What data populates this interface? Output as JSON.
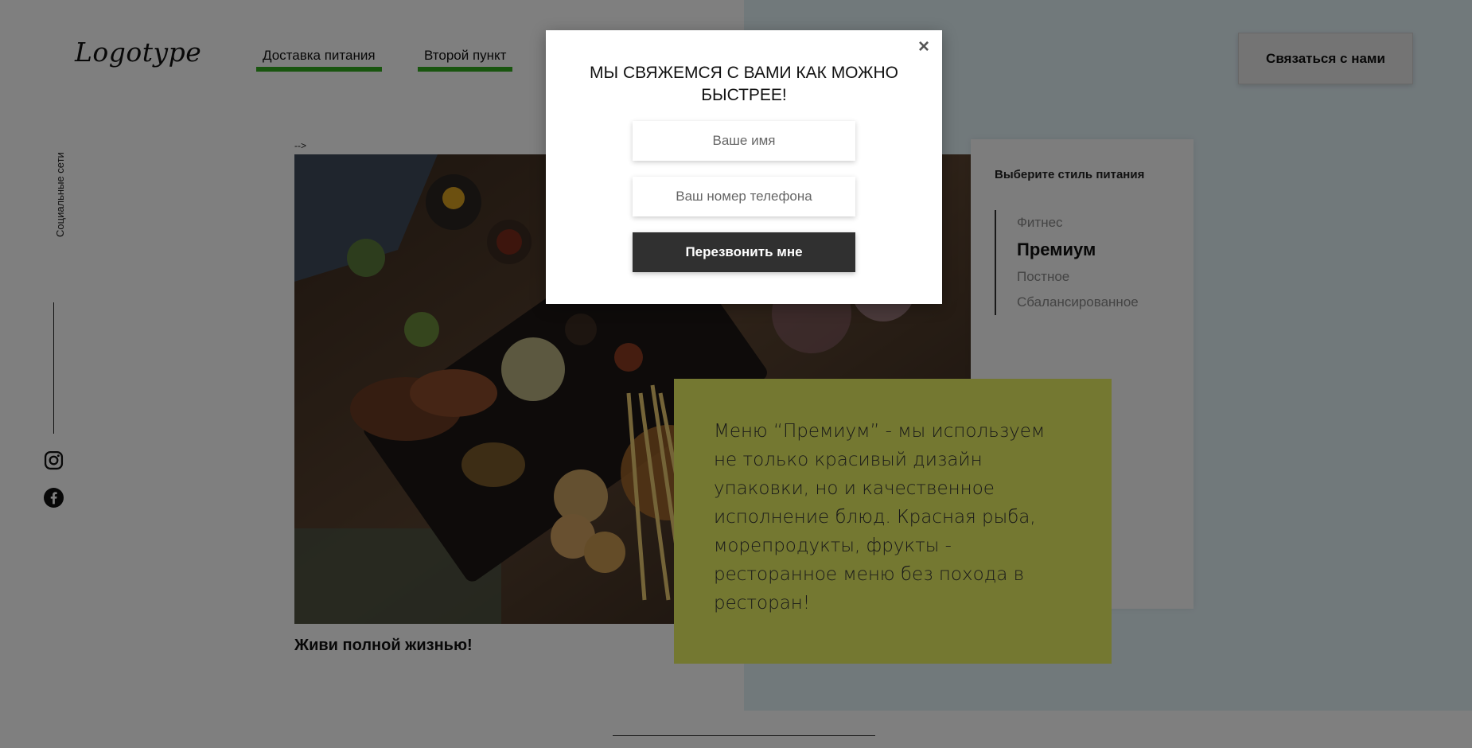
{
  "header": {
    "logo": "Logotype",
    "nav": [
      {
        "label": "Доставка питания"
      },
      {
        "label": "Второй пункт"
      }
    ],
    "contact_button": "Связаться с нами"
  },
  "social": {
    "label": "Социальные сети",
    "icons": [
      "instagram-icon",
      "facebook-icon"
    ]
  },
  "content": {
    "comment_artifact": "-->",
    "caption": "Живи полной жизнью!",
    "description": "Меню “Премиум” - мы используем не только красивый дизайн упаковки, но и качественное исполнение блюд. Красная рыба, морепродукты, фрукты - ресторанное меню без похода в ресторан!"
  },
  "menu": {
    "title": "Выберите стиль питания",
    "items": [
      {
        "label": "Фитнес",
        "active": false
      },
      {
        "label": "Премиум",
        "active": true
      },
      {
        "label": "Постное",
        "active": false
      },
      {
        "label": "Сбалансированное",
        "active": false
      }
    ]
  },
  "modal": {
    "title": "МЫ СВЯЖЕМСЯ С ВАМИ КАК МОЖНО БЫСТРЕЕ!",
    "close_label": "×",
    "name_placeholder": "Ваше имя",
    "phone_placeholder": "Ваш номер телефона",
    "submit_label": "Перезвонить мне"
  },
  "colors": {
    "accent_green": "#33aa1f",
    "highlight_yellow": "#e9f163",
    "right_bg": "#e3f2f7",
    "overlay": "rgba(0,0,0,0.5)",
    "button_dark": "#303030"
  }
}
